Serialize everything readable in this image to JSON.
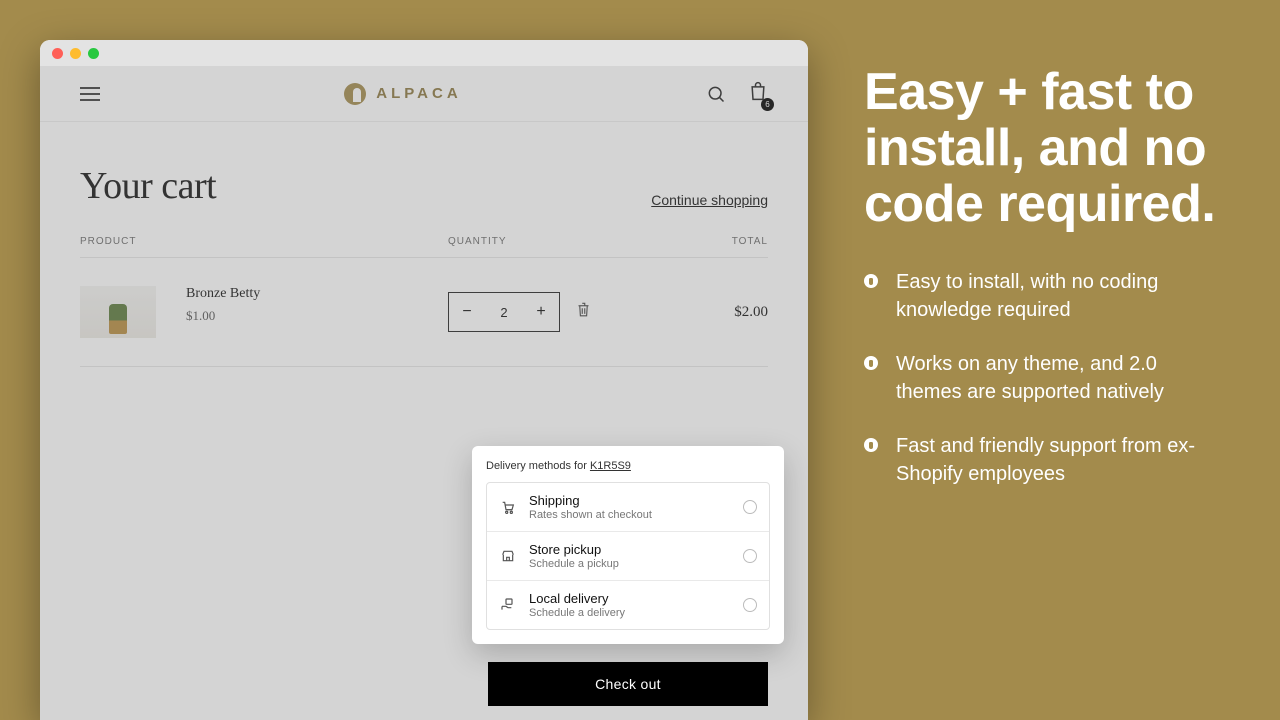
{
  "marketing": {
    "headline": "Easy + fast to install, and no code required.",
    "bullets": [
      "Easy to install, with no coding knowledge required",
      "Works on any theme, and 2.0 themes are supported natively",
      "Fast and friendly support from ex-Shopify employees"
    ]
  },
  "header": {
    "brand": "ALPACA",
    "cart_count": "6"
  },
  "cart": {
    "title": "Your cart",
    "continue_label": "Continue shopping",
    "columns": {
      "product": "PRODUCT",
      "quantity": "QUANTITY",
      "total": "TOTAL"
    },
    "items": [
      {
        "name": "Bronze Betty",
        "unit_price": "$1.00",
        "qty": "2",
        "line_total": "$2.00"
      }
    ],
    "checkout_label": "Check out"
  },
  "delivery": {
    "title_prefix": "Delivery methods for ",
    "zip": "K1R5S9",
    "options": [
      {
        "name": "Shipping",
        "sub": "Rates shown at checkout"
      },
      {
        "name": "Store pickup",
        "sub": "Schedule a pickup"
      },
      {
        "name": "Local delivery",
        "sub": "Schedule a delivery"
      }
    ]
  }
}
